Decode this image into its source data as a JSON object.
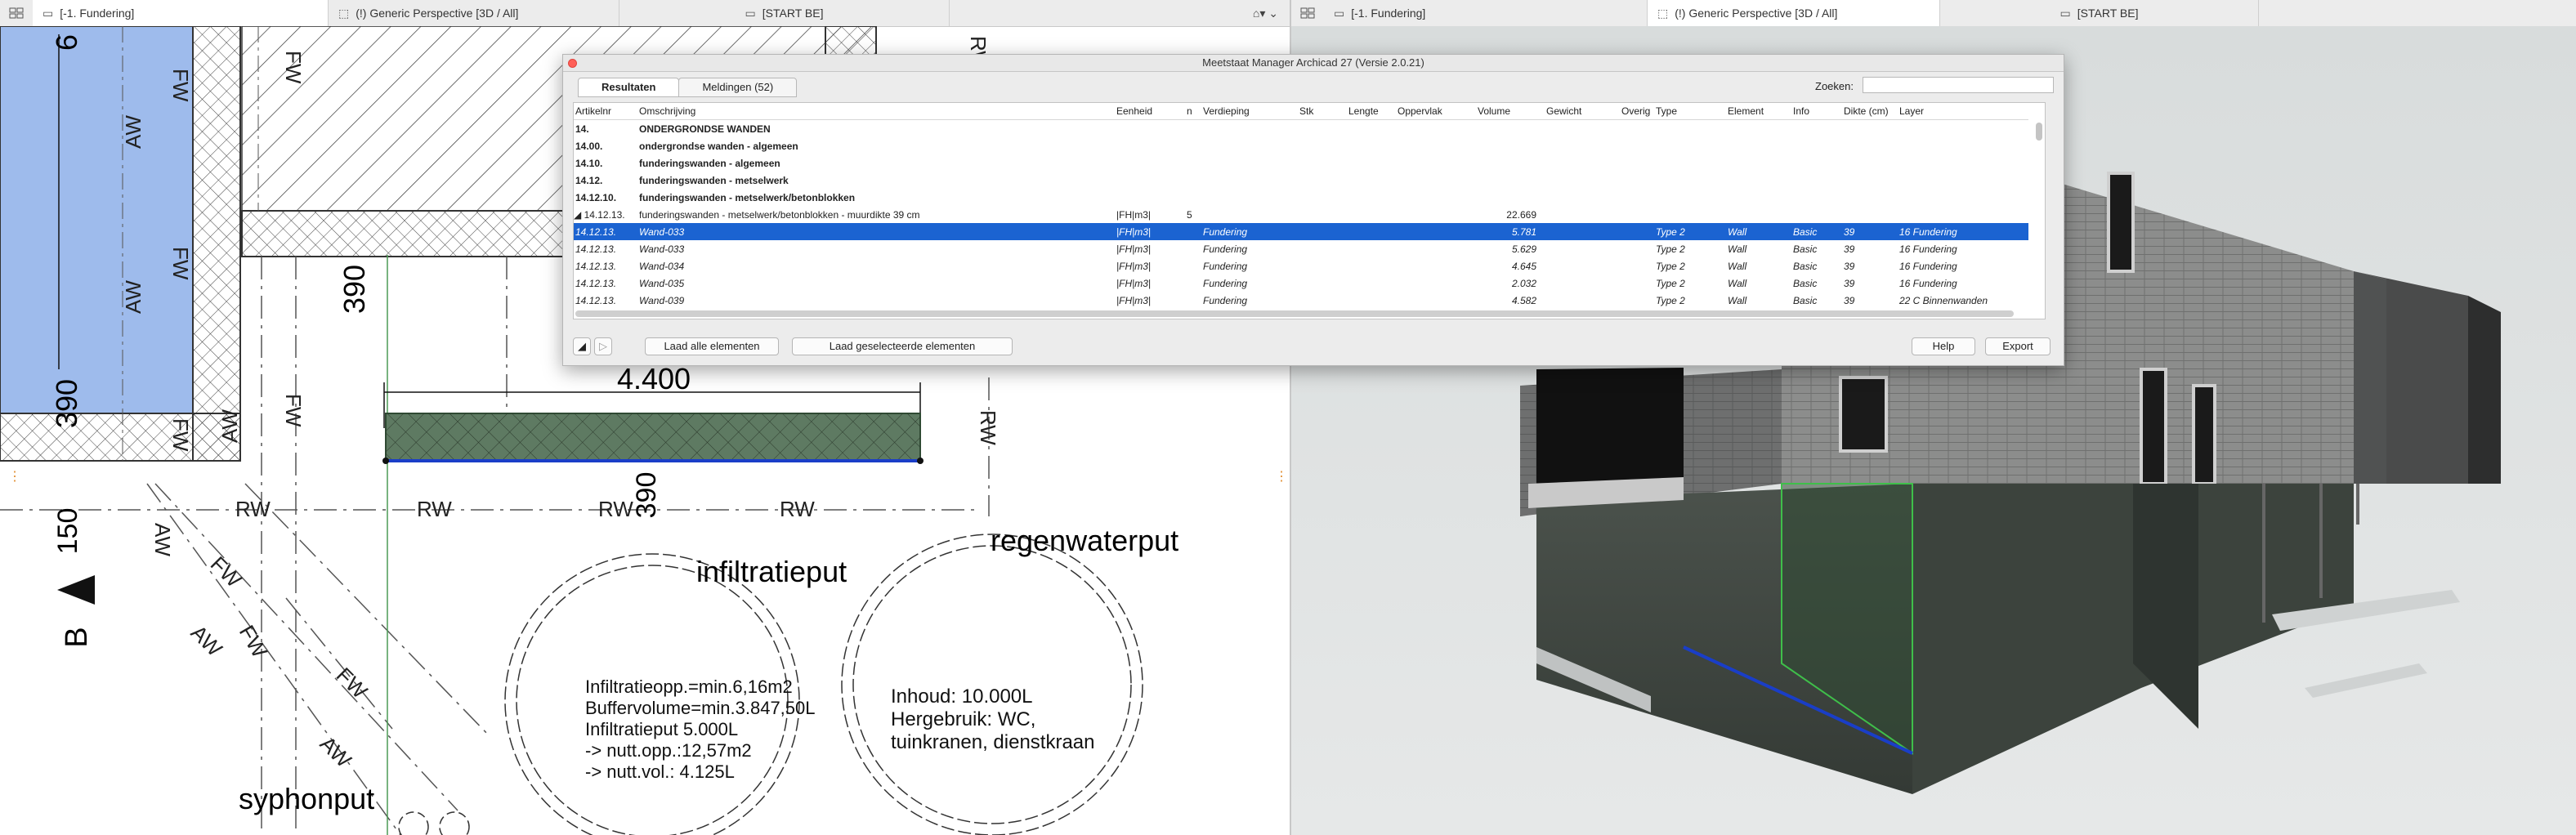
{
  "left_view": {
    "tabs": [
      {
        "label": "[-1. Fundering]",
        "icon": "floor-plan-icon"
      },
      {
        "label": "(!) Generic Perspective [3D / All]",
        "icon": "perspective-icon"
      },
      {
        "label": "[START BE]",
        "icon": "layout-icon"
      }
    ],
    "plan": {
      "dim_6": "6",
      "dim_390_left": "390",
      "dim_390_mid": "390",
      "dim_390_beam": "390",
      "dim_4400": "4.400",
      "dim_150": "150",
      "section_marker": "B",
      "labels": {
        "fw": "FW",
        "aw": "AW",
        "rw": "RW"
      },
      "infiltratieput_title": "infiltratieput",
      "regenwaterput_title": "regenwaterput",
      "syphonput_title": "syphonput",
      "infiltratie_lines": [
        "Infiltratieopp.=min.6,16m2",
        "Buffervolume=min.3.847,50L",
        "Infiltratieput 5.000L",
        "-> nutt.opp.:12,57m2",
        "-> nutt.vol.: 4.125L"
      ],
      "regenwater_lines": [
        "Inhoud: 10.000L",
        "Hergebruik: WC,",
        "tuinkranen, dienstkraan"
      ]
    }
  },
  "right_view": {
    "tabs": [
      {
        "label": "[-1. Fundering]",
        "icon": "floor-plan-icon"
      },
      {
        "label": "(!) Generic Perspective [3D / All]",
        "icon": "perspective-icon"
      },
      {
        "label": "[START BE]",
        "icon": "layout-icon"
      }
    ]
  },
  "dialog": {
    "title": "Meetstaat Manager Archicad 27 (Versie 2.0.21)",
    "tabs": [
      "Resultaten",
      "Meldingen (52)"
    ],
    "search_label": "Zoeken:",
    "search_value": "",
    "columns": [
      "Artikelnr",
      "Omschrijving",
      "Eenheid",
      "n",
      "Verdieping",
      "Stk",
      "Lengte",
      "Oppervlak",
      "Volume",
      "Gewicht",
      "Overig",
      "Type",
      "Element",
      "Info",
      "Dikte (cm)",
      "Layer"
    ],
    "rows": [
      {
        "style": "bold",
        "cells": [
          "14.",
          "ONDERGRONDSE WANDEN",
          "",
          "",
          "",
          "",
          "",
          "",
          "",
          "",
          "",
          "",
          "",
          "",
          "",
          ""
        ]
      },
      {
        "style": "bold",
        "cells": [
          "14.00.",
          "ondergrondse wanden - algemeen",
          "",
          "",
          "",
          "",
          "",
          "",
          "",
          "",
          "",
          "",
          "",
          "",
          "",
          ""
        ]
      },
      {
        "style": "bold",
        "cells": [
          "14.10.",
          "funderingswanden - algemeen",
          "",
          "",
          "",
          "",
          "",
          "",
          "",
          "",
          "",
          "",
          "",
          "",
          "",
          ""
        ]
      },
      {
        "style": "bold",
        "cells": [
          "14.12.",
          "funderingswanden - metselwerk",
          "",
          "",
          "",
          "",
          "",
          "",
          "",
          "",
          "",
          "",
          "",
          "",
          "",
          ""
        ]
      },
      {
        "style": "bold",
        "cells": [
          "14.12.10.",
          "funderingswanden - metselwerk/betonblokken",
          "",
          "",
          "",
          "",
          "",
          "",
          "",
          "",
          "",
          "",
          "",
          "",
          "",
          ""
        ]
      },
      {
        "style": "group",
        "cells": [
          "14.12.13.",
          "funderingswanden - metselwerk/betonblokken - muurdikte 39 cm",
          "|FH|m3|",
          "5",
          "",
          "",
          "",
          "",
          "22.669",
          "",
          "",
          "",
          "",
          "",
          "",
          ""
        ]
      },
      {
        "style": "sel",
        "cells": [
          "14.12.13.",
          "Wand-033",
          "|FH|m3|",
          "",
          "Fundering",
          "",
          "",
          "",
          "5.781",
          "",
          "",
          "Type 2",
          "Wall",
          "Basic",
          "39",
          "16 Fundering"
        ]
      },
      {
        "style": "sub",
        "cells": [
          "14.12.13.",
          "Wand-033",
          "|FH|m3|",
          "",
          "Fundering",
          "",
          "",
          "",
          "5.629",
          "",
          "",
          "Type 2",
          "Wall",
          "Basic",
          "39",
          "16 Fundering"
        ]
      },
      {
        "style": "sub",
        "cells": [
          "14.12.13.",
          "Wand-034",
          "|FH|m3|",
          "",
          "Fundering",
          "",
          "",
          "",
          "4.645",
          "",
          "",
          "Type 2",
          "Wall",
          "Basic",
          "39",
          "16 Fundering"
        ]
      },
      {
        "style": "sub",
        "cells": [
          "14.12.13.",
          "Wand-035",
          "|FH|m3|",
          "",
          "Fundering",
          "",
          "",
          "",
          "2.032",
          "",
          "",
          "Type 2",
          "Wall",
          "Basic",
          "39",
          "16 Fundering"
        ]
      },
      {
        "style": "sub",
        "cells": [
          "14.12.13.",
          "Wand-039",
          "|FH|m3|",
          "",
          "Fundering",
          "",
          "",
          "",
          "4.582",
          "",
          "",
          "Type 2",
          "Wall",
          "Basic",
          "39",
          "22 C Binnenwanden"
        ]
      }
    ],
    "buttons": {
      "load_all": "Laad alle elementen",
      "load_selected": "Laad geselecteerde elementen",
      "help": "Help",
      "export": "Export"
    }
  },
  "colors": {
    "selection": "#1b63d1",
    "plan_wall_fill": "#5e7a62",
    "plan_blue_fill": "#9ebbec"
  }
}
